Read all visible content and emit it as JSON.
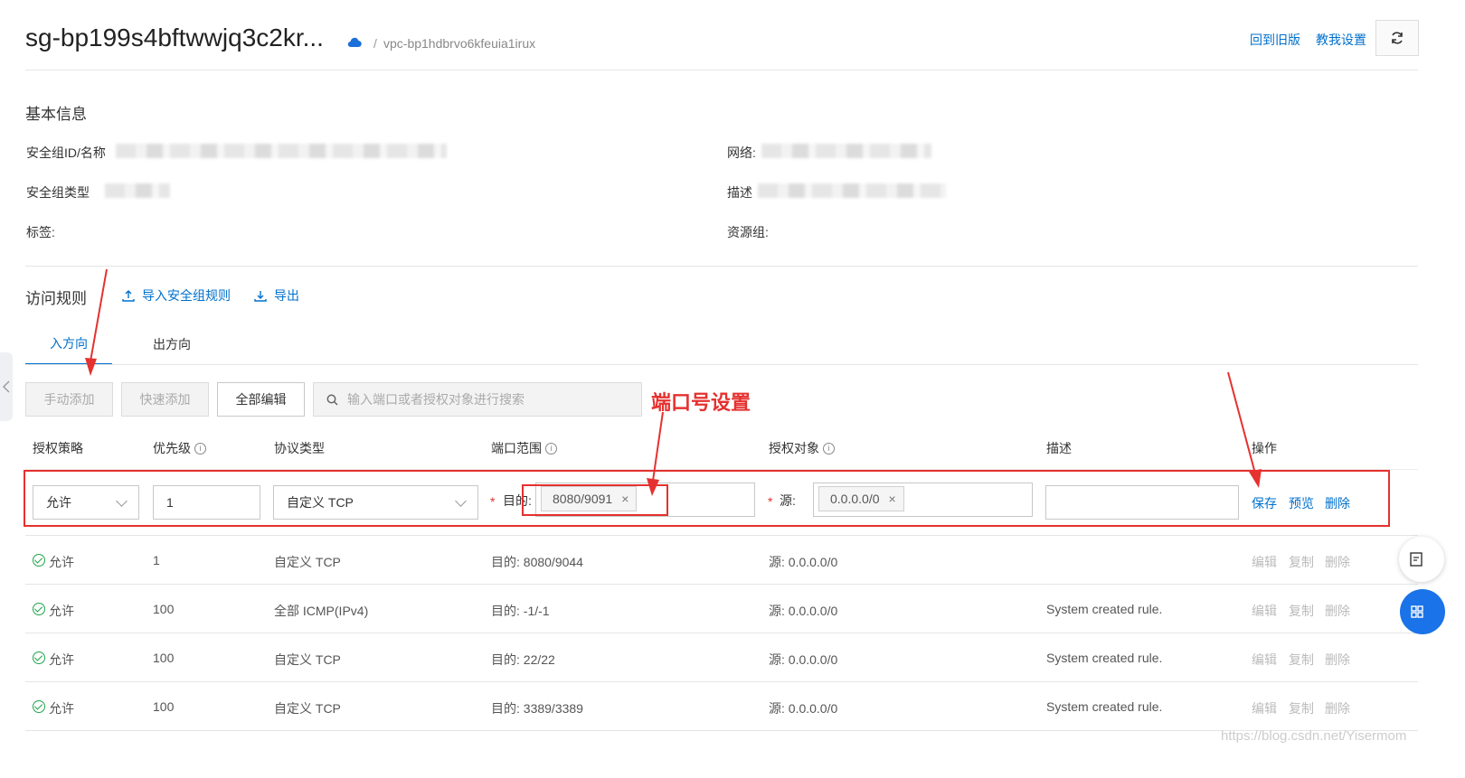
{
  "header": {
    "title": "sg-bp199s4bftwwjq3c2kr...",
    "breadcrumb_sep": "/",
    "vpc": "vpc-bp1hdbrvo6kfeuia1irux",
    "back_old": "回到旧版",
    "teach": "教我设置"
  },
  "basic": {
    "heading": "基本信息",
    "sg_id_label": "安全组ID/名称",
    "sg_type_label": "安全组类型",
    "tags_label": "标签:",
    "network_label": "网络:",
    "desc_label": "描述",
    "resgroup_label": "资源组:"
  },
  "rules": {
    "heading": "访问规则",
    "import": "导入安全组规则",
    "export": "导出",
    "tab_in": "入方向",
    "tab_out": "出方向",
    "btn_manual": "手动添加",
    "btn_quick": "快速添加",
    "btn_edit_all": "全部编辑",
    "search_placeholder": "输入端口或者授权对象进行搜索",
    "annotation": "端口号设置"
  },
  "columns": {
    "policy": "授权策略",
    "priority": "优先级",
    "protocol": "协议类型",
    "port": "端口范围",
    "auth": "授权对象",
    "desc": "描述",
    "ops": "操作"
  },
  "edit_row": {
    "policy": "允许",
    "priority": "1",
    "protocol": "自定义 TCP",
    "dest_label": "目的:",
    "dest_tag": "8080/9091",
    "src_label": "源:",
    "src_tag": "0.0.0.0/0",
    "save": "保存",
    "preview": "预览",
    "delete": "删除",
    "required_mark": "*"
  },
  "rows": [
    {
      "policy": "允许",
      "priority": "1",
      "protocol": "自定义 TCP",
      "port": "目的: 8080/9044",
      "auth": "源: 0.0.0.0/0",
      "desc": ""
    },
    {
      "policy": "允许",
      "priority": "100",
      "protocol": "全部 ICMP(IPv4)",
      "port": "目的: -1/-1",
      "auth": "源: 0.0.0.0/0",
      "desc": "System created rule."
    },
    {
      "policy": "允许",
      "priority": "100",
      "protocol": "自定义 TCP",
      "port": "目的: 22/22",
      "auth": "源: 0.0.0.0/0",
      "desc": "System created rule."
    },
    {
      "policy": "允许",
      "priority": "100",
      "protocol": "自定义 TCP",
      "port": "目的: 3389/3389",
      "auth": "源: 0.0.0.0/0",
      "desc": "System created rule."
    }
  ],
  "row_ops": {
    "edit": "编辑",
    "copy": "复制",
    "delete": "删除"
  },
  "watermark": "https://blog.csdn.net/Yisermom"
}
